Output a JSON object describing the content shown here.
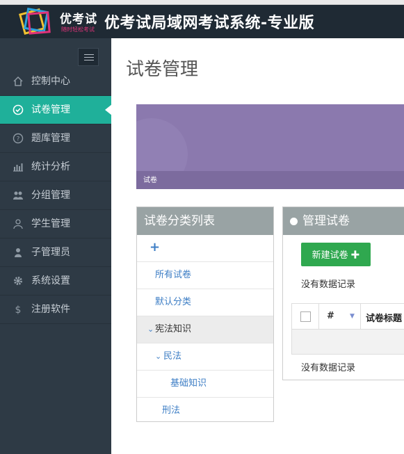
{
  "header": {
    "logo_text": "优考试",
    "logo_sub": "随时轻松考试",
    "title": "优考试局域网考试系统-专业版"
  },
  "sidebar": {
    "items": [
      {
        "label": "控制中心",
        "icon": "home-icon"
      },
      {
        "label": "试卷管理",
        "icon": "check-circle-icon",
        "active": true
      },
      {
        "label": "题库管理",
        "icon": "question-circle-icon"
      },
      {
        "label": "统计分析",
        "icon": "bar-chart-icon"
      },
      {
        "label": "分组管理",
        "icon": "users-icon"
      },
      {
        "label": "学生管理",
        "icon": "user-outline-icon"
      },
      {
        "label": "子管理员",
        "icon": "user-icon"
      },
      {
        "label": "系统设置",
        "icon": "gear-icon"
      },
      {
        "label": "注册软件",
        "icon": "dollar-icon"
      }
    ]
  },
  "main": {
    "page_title": "试卷管理",
    "banner_text": "试卷"
  },
  "categories": {
    "title": "试卷分类列表",
    "add_symbol": "+",
    "items": [
      "所有试卷",
      "默认分类",
      "宪法知识",
      "民法",
      "基础知识",
      "刑法"
    ]
  },
  "exams": {
    "title": "管理试卷",
    "new_button": "新建试卷",
    "new_button_symbol": "✚",
    "no_data_top": "没有数据记录",
    "no_data_bottom": "没有数据记录",
    "columns": [
      "#",
      "试卷标题"
    ]
  },
  "colors": {
    "header_bg": "#1f2a34",
    "sidebar_bg": "#2e3a45",
    "active_item": "#1fb09a",
    "banner": "#8b79ae",
    "panel_head": "#99a3a4",
    "button_green": "#2fa84f",
    "link_blue": "#3d7ec5"
  }
}
